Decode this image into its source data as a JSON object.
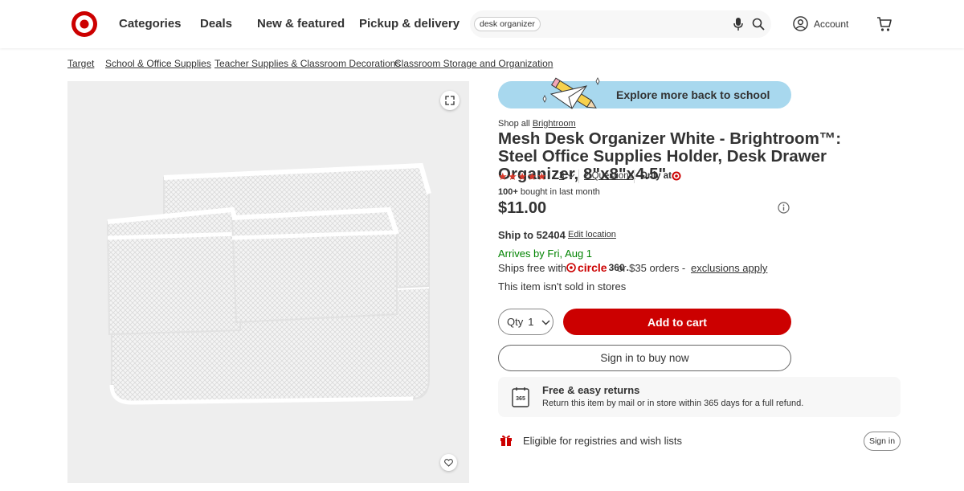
{
  "header": {
    "nav": [
      "Categories",
      "Deals",
      "New & featured",
      "Pickup & delivery"
    ],
    "search": {
      "chip": "desk organizer"
    },
    "account_label": "Account"
  },
  "breadcrumb": [
    "Target",
    "School & Office Supplies",
    "Teacher Supplies & Classroom Decorations",
    "Classroom Storage and Organization"
  ],
  "promo": {
    "text": "Explore more back to school"
  },
  "product": {
    "shop_all_prefix": "Shop all",
    "brand": "Brightroom",
    "title": "Mesh Desk Organizer White - Brightroom™: Steel Office Supplies Holder, Desk Drawer Organizer, 8\"x8\"x4.5\"",
    "stars": "★★★★★",
    "rating": 5,
    "rating_count": "3",
    "questions": "2 Questions",
    "only_at": "Only at",
    "bought_count": "100+",
    "bought_suffix": " bought in last month",
    "price": "$11.00"
  },
  "shipping": {
    "ship_to": "Ship to 52404",
    "edit_location": "Edit location",
    "arrives": "Arrives by Fri, Aug 1",
    "ships_free": "Ships free with",
    "circle_word": "circle",
    "circle_num": "360",
    "circle_dot": ".",
    "or_orders": "or $35 orders -",
    "exclusions": "exclusions apply",
    "not_sold": "This item isn't sold in stores"
  },
  "actions": {
    "qty_label": "Qty",
    "qty_value": "1",
    "add_to_cart": "Add to cart",
    "sign_in_buy": "Sign in to buy now"
  },
  "returns": {
    "title": "Free & easy returns",
    "desc": "Return this item by mail or in store within 365 days for a full refund.",
    "icon_text": "365"
  },
  "registries": {
    "text": "Eligible for registries and wish lists",
    "sign_in": "Sign in"
  },
  "colors": {
    "brand_red": "#cc0000",
    "promo_blue": "#a8d8ee",
    "arrival_green": "#008300"
  }
}
